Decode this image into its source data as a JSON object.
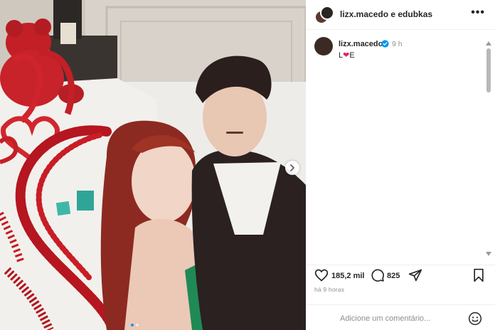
{
  "post": {
    "header_title": "lizx.macedo e edubkas",
    "more_label": "•••",
    "caption_user": "lizx.macedo",
    "caption_time": "9 h",
    "caption_prefix": "L",
    "caption_heart": "❤",
    "caption_suffix": "E",
    "likes_count": "185,2 mil",
    "comments_count": "825",
    "posted_ago": "há 9 horas"
  },
  "comment": {
    "placeholder": "Adicione um comentário..."
  },
  "carousel": {
    "slides": 2,
    "active_slide": 1
  },
  "icons": [
    "more-options-icon",
    "verified-badge-icon",
    "heart-icon",
    "comment-icon",
    "share-icon",
    "bookmark-icon",
    "emoji-icon",
    "chevron-right-icon"
  ],
  "colors": {
    "verified": "#0095f6",
    "heart": "#e0245e",
    "text": "#262626",
    "muted": "#8e8e8e"
  }
}
